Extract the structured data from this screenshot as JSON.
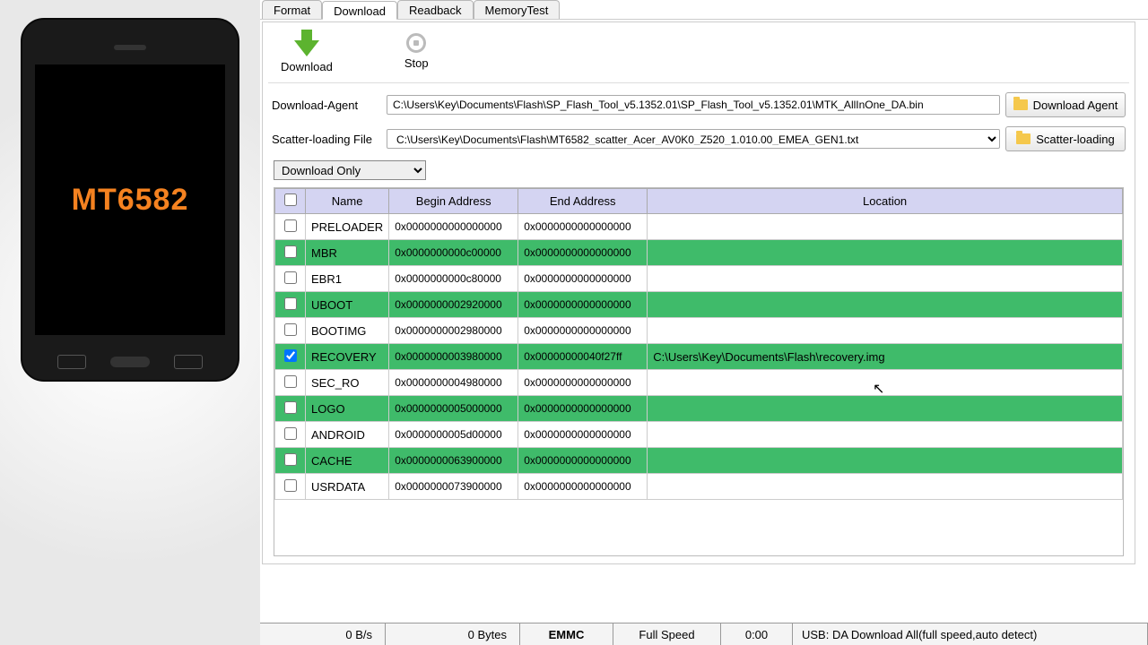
{
  "phone": {
    "label": "MT6582"
  },
  "tabs": [
    {
      "label": "Format",
      "active": false
    },
    {
      "label": "Download",
      "active": true
    },
    {
      "label": "Readback",
      "active": false
    },
    {
      "label": "MemoryTest",
      "active": false
    }
  ],
  "toolbar": {
    "download_label": "Download",
    "stop_label": "Stop"
  },
  "form": {
    "da_label": "Download-Agent",
    "da_value": "C:\\Users\\Key\\Documents\\Flash\\SP_Flash_Tool_v5.1352.01\\SP_Flash_Tool_v5.1352.01\\MTK_AllInOne_DA.bin",
    "da_btn": "Download Agent",
    "scatter_label": "Scatter-loading File",
    "scatter_value": "C:\\Users\\Key\\Documents\\Flash\\MT6582_scatter_Acer_AV0K0_Z520_1.010.00_EMEA_GEN1.txt",
    "scatter_btn": "Scatter-loading",
    "mode": "Download Only"
  },
  "table": {
    "headers": {
      "name": "Name",
      "begin": "Begin Address",
      "end": "End Address",
      "loc": "Location"
    },
    "rows": [
      {
        "checked": false,
        "green": false,
        "name": "PRELOADER",
        "begin": "0x0000000000000000",
        "end": "0x0000000000000000",
        "loc": ""
      },
      {
        "checked": false,
        "green": true,
        "name": "MBR",
        "begin": "0x0000000000c00000",
        "end": "0x0000000000000000",
        "loc": ""
      },
      {
        "checked": false,
        "green": false,
        "name": "EBR1",
        "begin": "0x0000000000c80000",
        "end": "0x0000000000000000",
        "loc": ""
      },
      {
        "checked": false,
        "green": true,
        "name": "UBOOT",
        "begin": "0x0000000002920000",
        "end": "0x0000000000000000",
        "loc": ""
      },
      {
        "checked": false,
        "green": false,
        "name": "BOOTIMG",
        "begin": "0x0000000002980000",
        "end": "0x0000000000000000",
        "loc": ""
      },
      {
        "checked": true,
        "green": true,
        "name": "RECOVERY",
        "begin": "0x0000000003980000",
        "end": "0x00000000040f27ff",
        "loc": "C:\\Users\\Key\\Documents\\Flash\\recovery.img"
      },
      {
        "checked": false,
        "green": false,
        "name": "SEC_RO",
        "begin": "0x0000000004980000",
        "end": "0x0000000000000000",
        "loc": ""
      },
      {
        "checked": false,
        "green": true,
        "name": "LOGO",
        "begin": "0x0000000005000000",
        "end": "0x0000000000000000",
        "loc": ""
      },
      {
        "checked": false,
        "green": false,
        "name": "ANDROID",
        "begin": "0x0000000005d00000",
        "end": "0x0000000000000000",
        "loc": ""
      },
      {
        "checked": false,
        "green": true,
        "name": "CACHE",
        "begin": "0x0000000063900000",
        "end": "0x0000000000000000",
        "loc": ""
      },
      {
        "checked": false,
        "green": false,
        "name": "USRDATA",
        "begin": "0x0000000073900000",
        "end": "0x0000000000000000",
        "loc": ""
      }
    ]
  },
  "status": {
    "speed": "0 B/s",
    "bytes": "0 Bytes",
    "storage": "EMMC",
    "usb_speed": "Full Speed",
    "time": "0:00",
    "mode": "USB: DA Download All(full speed,auto detect)"
  }
}
